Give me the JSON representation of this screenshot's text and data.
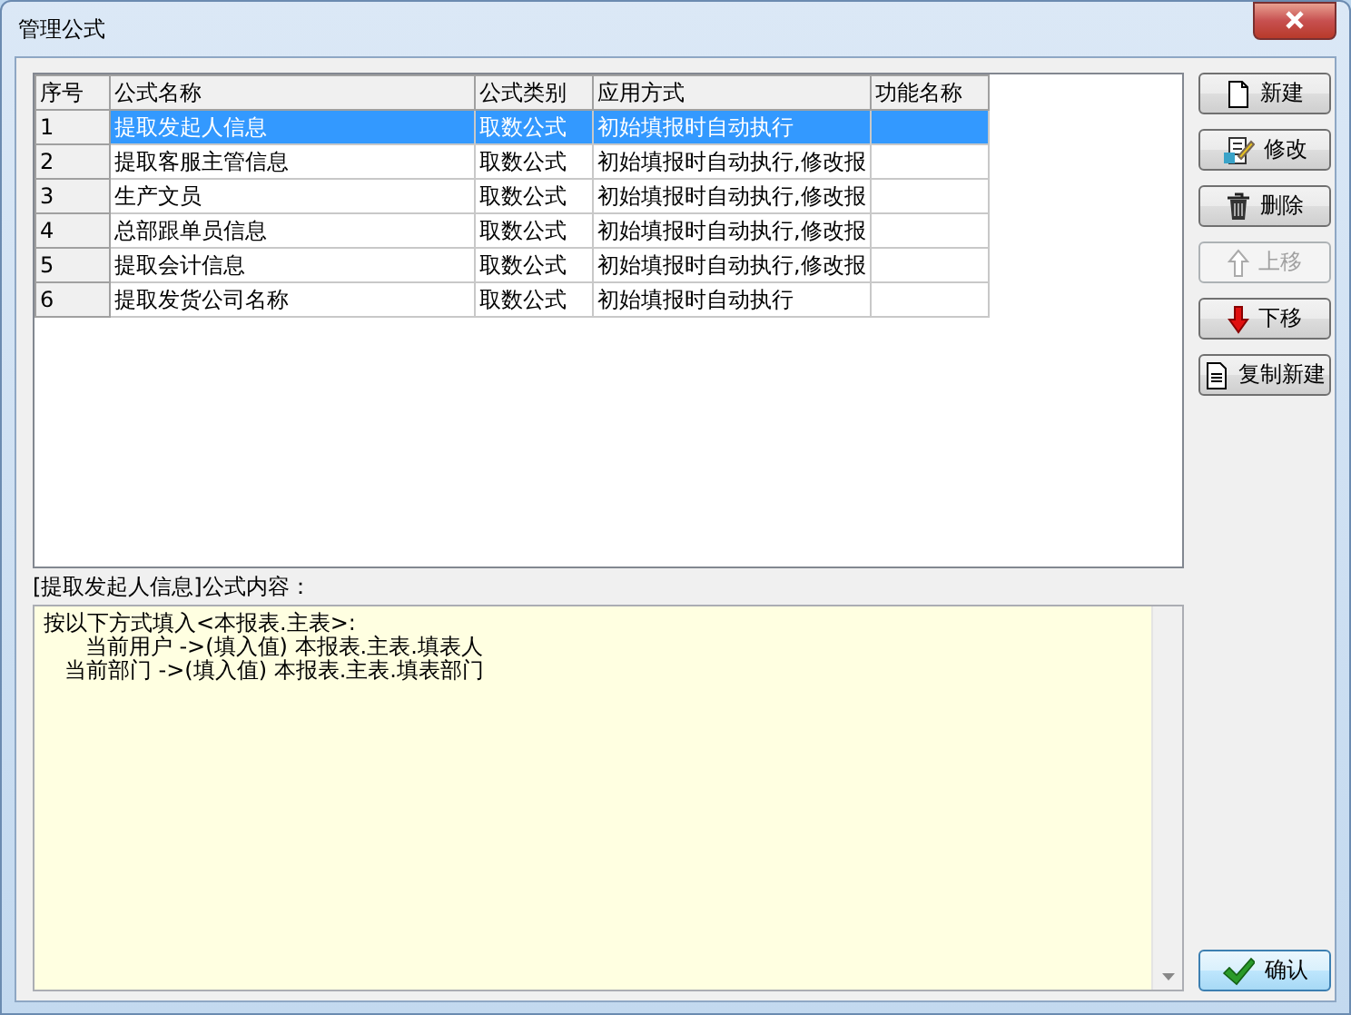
{
  "window": {
    "title": "管理公式"
  },
  "table": {
    "columns": [
      "序号",
      "公式名称",
      "公式类别",
      "应用方式",
      "功能名称"
    ],
    "rows": [
      {
        "cells": [
          "1",
          "提取发起人信息",
          "取数公式",
          "初始填报时自动执行"
        ],
        "selected": true
      },
      {
        "cells": [
          "2",
          "提取客服主管信息",
          "取数公式",
          "初始填报时自动执行,修改报"
        ],
        "selected": false
      },
      {
        "cells": [
          "3",
          "生产文员",
          "取数公式",
          "初始填报时自动执行,修改报"
        ],
        "selected": false
      },
      {
        "cells": [
          "4",
          "总部跟单员信息",
          "取数公式",
          "初始填报时自动执行,修改报"
        ],
        "selected": false
      },
      {
        "cells": [
          "5",
          "提取会计信息",
          "取数公式",
          "初始填报时自动执行,修改报"
        ],
        "selected": false
      },
      {
        "cells": [
          "6",
          "提取发货公司名称",
          "取数公式",
          "初始填报时自动执行"
        ],
        "selected": false
      }
    ]
  },
  "formula": {
    "label": "[提取发起人信息]公式内容：",
    "lines": [
      "按以下方式填入<本报表.主表>:",
      "      当前用户 ->(填入值) 本报表.主表.填表人",
      "   当前部门 ->(填入值) 本报表.主表.填表部门"
    ]
  },
  "buttons": [
    {
      "label": "新建",
      "kind": "new",
      "disabled": false
    },
    {
      "label": "修改",
      "kind": "edit",
      "disabled": false
    },
    {
      "label": "删除",
      "kind": "delete",
      "disabled": false
    },
    {
      "label": "上移",
      "kind": "up",
      "disabled": true
    },
    {
      "label": "下移",
      "kind": "down",
      "disabled": false
    },
    {
      "label": "复制新建",
      "kind": "copy",
      "disabled": false
    }
  ],
  "confirm": {
    "label": "确认"
  }
}
